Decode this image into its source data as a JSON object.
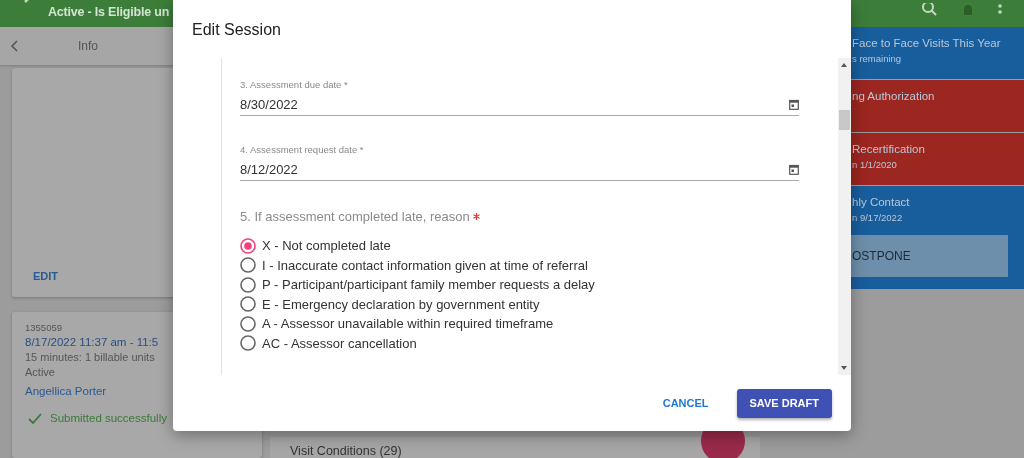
{
  "app_bar": {
    "title": "Active - Is Eligible un"
  },
  "info_panel": {
    "title": "Info",
    "edit_button": "EDIT"
  },
  "session_card": {
    "id": "1355059",
    "time": "8/17/2022 11:37 am - 11:5",
    "duration": "15 minutes: 1 billable units",
    "status": "Active",
    "staff": "Angellica Porter",
    "submission": "Submitted successfully"
  },
  "visit_conditions": "Visit Conditions (29)",
  "alerts": [
    {
      "kind": "info",
      "title": "Face to Face Visits This Year",
      "subtitle": "s remaining"
    },
    {
      "kind": "warning",
      "title": "ng Authorization"
    },
    {
      "kind": "warning",
      "title": "Recertification",
      "subtitle": "n 1/1/2020"
    },
    {
      "kind": "info",
      "title": "hly Contact",
      "subtitle": "n 9/17/2022",
      "action": "OSTPONE"
    }
  ],
  "dialog": {
    "title": "Edit Session",
    "fields": [
      {
        "label": "3. Assessment due date *",
        "value": "8/30/2022"
      },
      {
        "label": "4. Assessment request date *",
        "value": "8/12/2022"
      }
    ],
    "question": {
      "text": "5. If assessment completed late, reason",
      "required": true
    },
    "options": [
      {
        "label": "X - Not completed late",
        "selected": true
      },
      {
        "label": "I - Inaccurate contact information given at time of referral",
        "selected": false
      },
      {
        "label": "P - Participant/participant family member requests a delay",
        "selected": false
      },
      {
        "label": "E - Emergency declaration by government entity",
        "selected": false
      },
      {
        "label": "A - Assessor unavailable within required timeframe",
        "selected": false
      },
      {
        "label": "AC - Assessor cancellation",
        "selected": false
      }
    ],
    "buttons": [
      {
        "kind": "text",
        "label": "CANCEL"
      },
      {
        "kind": "primary",
        "label": "SAVE DRAFT"
      }
    ]
  }
}
